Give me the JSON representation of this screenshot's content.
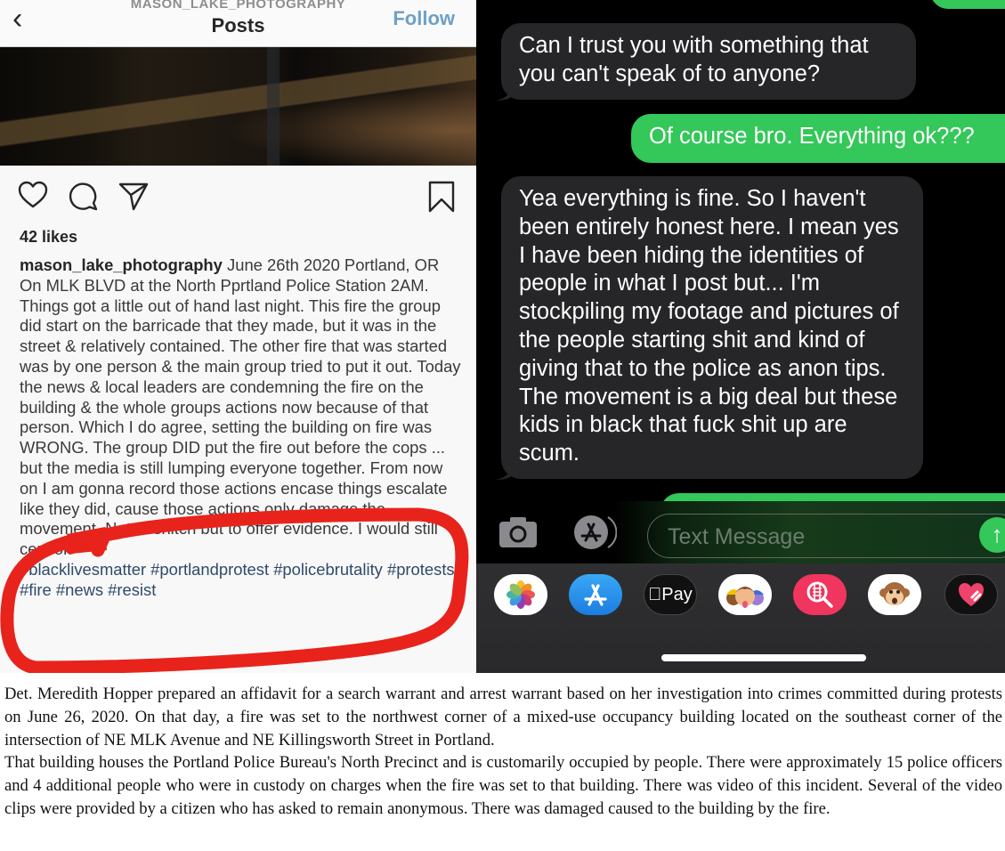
{
  "instagram": {
    "account_name": "MASON_LAKE_PHOTOGRAPHY",
    "title": "Posts",
    "follow_label": "Follow",
    "likes": "42 likes",
    "caption": {
      "username": "mason_lake_photography",
      "header_text": " June 26th 2020 Portland, OR",
      "location_line": "On MLK BLVD at the North Pprtland Police Station 2AM.",
      "body": "Things got a little out of hand last night. This fire the group did start on the barricade that they made, but it was in the street & relatively contained. The other fire that was started was by one person & the main group tried to put it out. Today the news & local leaders are condemning the fire on the building & the whole groups actions now because of that person. Which I do agree, setting the building on fire was WRONG. The group DID put the fire out before the cops ... but the media is still lumping everyone together. From now on I am gonna record those actions encase things escalate like they did, cause those actions only damage the movement. Not to snitch but to offer evidence. I would still censor.",
      "hashtags": "#blacklivesmatter #portlandprotest #policebrutality #protests #fire #news #resist"
    },
    "annotation_color": "#e8231c"
  },
  "imessage": {
    "messages": [
      {
        "direction": "outgoing",
        "text": ""
      },
      {
        "direction": "incoming",
        "text": "Can I trust you with something that you can't speak of to anyone?"
      },
      {
        "direction": "outgoing",
        "text": "Of course bro. Everything ok???"
      },
      {
        "direction": "incoming",
        "text": "Yea everything is fine. So I haven't been entirely honest here. I mean yes I have been hiding the identities of people in what I post but... I'm stockpiling my footage and pictures of the people starting shit and kind of giving that to the police as anon tips. The movement is a big deal but these kids in black that fuck shit up are scum."
      },
      {
        "direction": "outgoing",
        "text": ""
      }
    ],
    "composer": {
      "placeholder": "Text Message",
      "value": ""
    },
    "app_tray": [
      {
        "name": "Photos",
        "icon": "photos-icon"
      },
      {
        "name": "App Store",
        "icon": "app-store-icon"
      },
      {
        "name": "Apple Pay",
        "icon": "apple-pay-icon",
        "label": "Pay"
      },
      {
        "name": "Memoji Stickers",
        "icon": "memoji-icon"
      },
      {
        "name": "Images Search",
        "icon": "image-search-icon"
      },
      {
        "name": "Animoji",
        "icon": "monkey-animoji-icon"
      },
      {
        "name": "Digital Touch",
        "icon": "digital-touch-icon"
      }
    ],
    "colors": {
      "outgoing_bubble": "#34c759",
      "incoming_bubble": "#262628"
    }
  },
  "affidavit": {
    "paragraph_1": "Det. Meredith Hopper prepared an affidavit for a search warrant and arrest warrant based on her investigation into crimes committed during protests on June 26, 2020. On that day, a fire was set to the northwest corner of a mixed-use occupancy building located on the southeast corner of the intersection of NE MLK Avenue and NE Killingsworth Street in Portland.",
    "paragraph_2": "That building houses the Portland Police Bureau's North Precinct and is customarily occupied by people. There were approximately 15 police officers and 4 additional people who were in custody on charges when the fire was set to that building. There was video of this incident. Several of the video clips were provided by a citizen who has asked to remain anonymous. There was damaged caused to the building by the fire."
  }
}
